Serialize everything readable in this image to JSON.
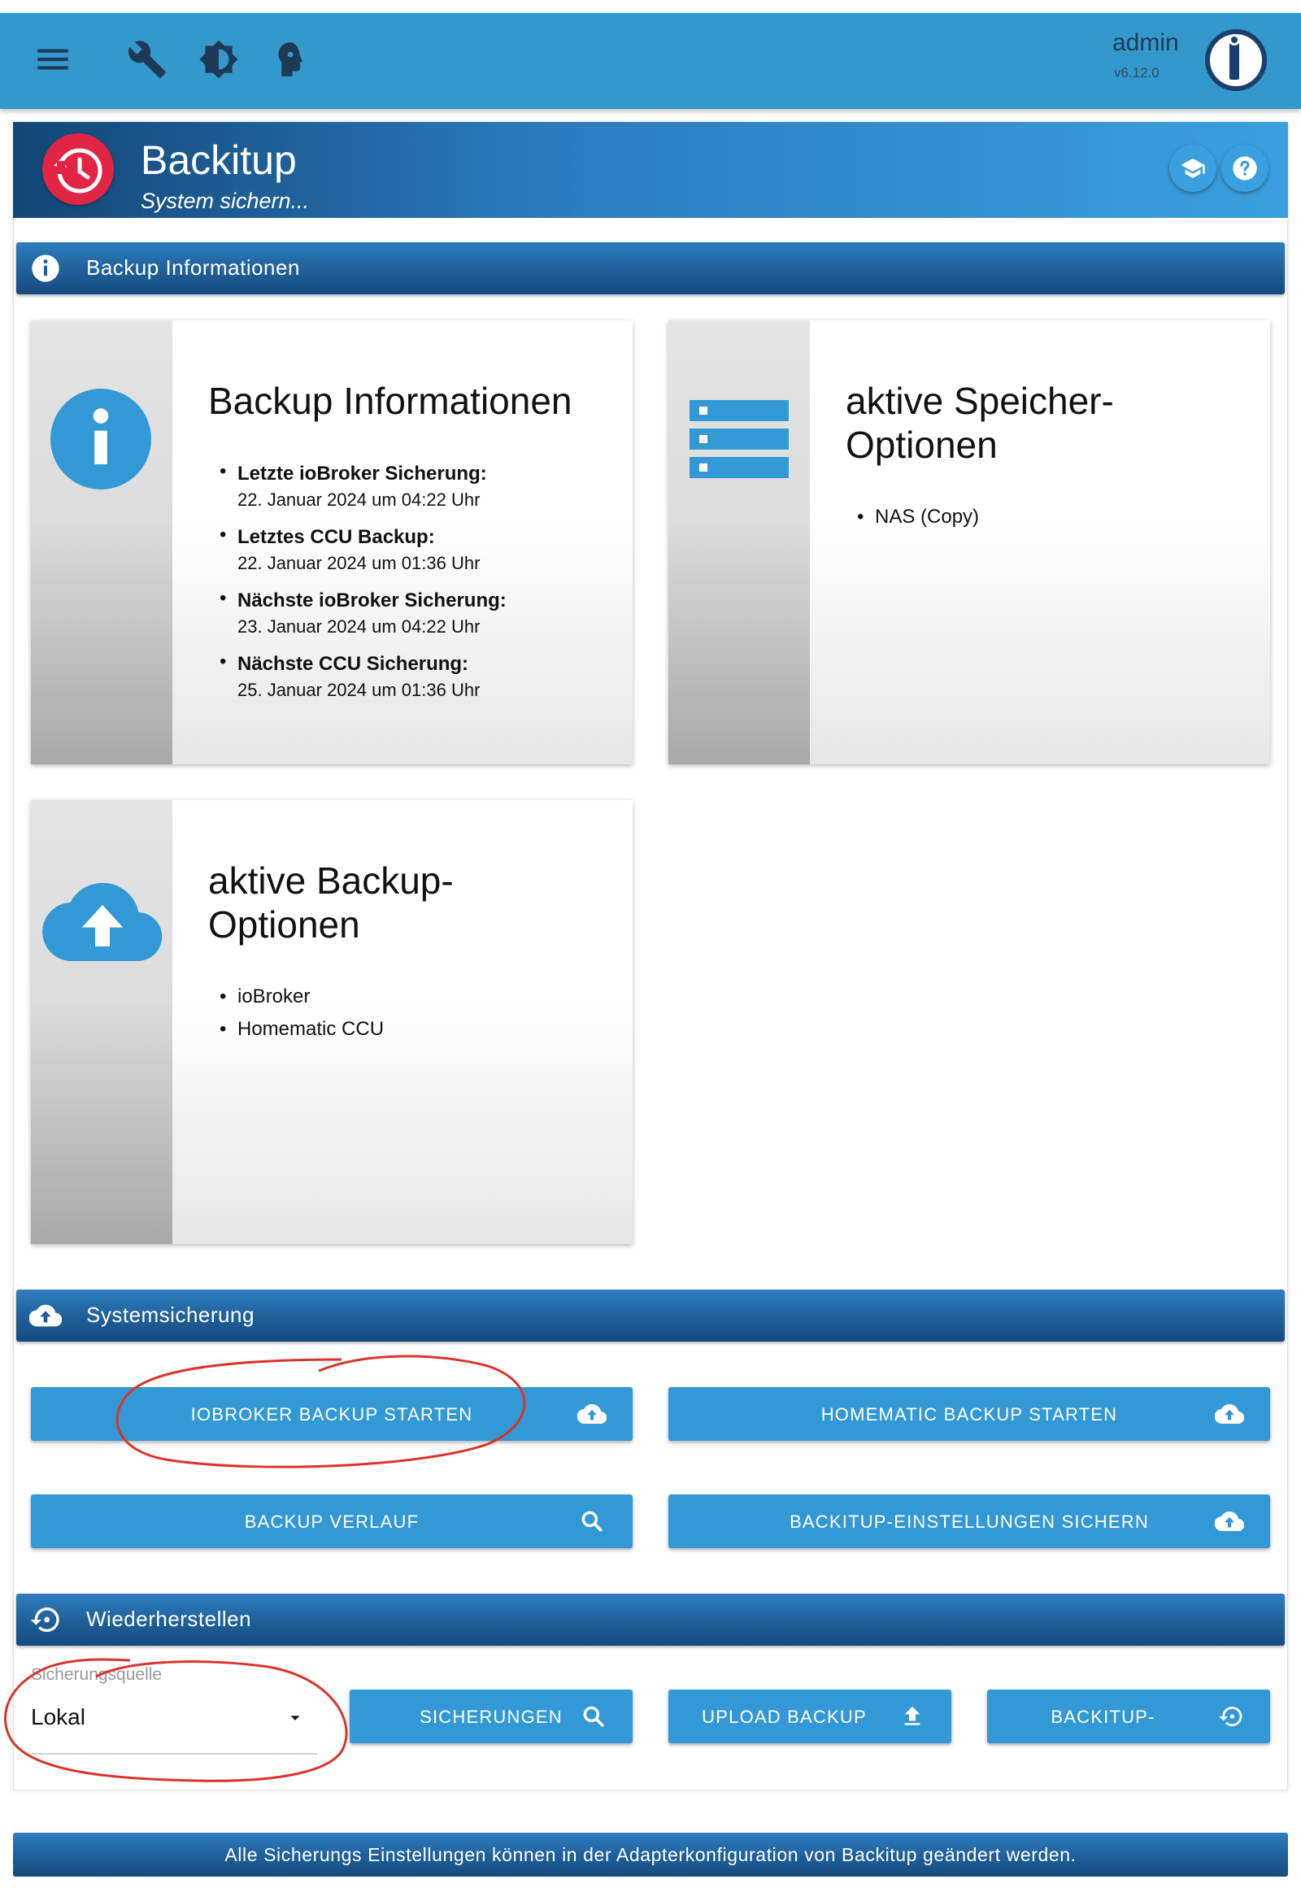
{
  "appbar": {
    "user": "admin",
    "version": "v6.12.0",
    "icons": [
      "menu-icon",
      "wrench-icon",
      "brightness-icon",
      "expert-mode-icon"
    ]
  },
  "adapter": {
    "title": "Backitup",
    "subtitle": "System sichern..."
  },
  "sections": {
    "info": "Backup Informationen",
    "system": "Systemsicherung",
    "restore": "Wiederherstellen"
  },
  "cards": {
    "backup_info": {
      "title": "Backup Informationen",
      "items": [
        {
          "label": "Letzte ioBroker Sicherung:",
          "value": "22. Januar 2024 um 04:22 Uhr"
        },
        {
          "label": "Letztes CCU Backup:",
          "value": "22. Januar 2024 um 01:36 Uhr"
        },
        {
          "label": "Nächste ioBroker Sicherung:",
          "value": "23. Januar 2024 um 04:22 Uhr"
        },
        {
          "label": "Nächste CCU Sicherung:",
          "value": "25. Januar 2024 um 01:36 Uhr"
        }
      ]
    },
    "storage": {
      "title": "aktive Speicher-Optionen",
      "items": [
        "NAS (Copy)"
      ]
    },
    "backup_options": {
      "title": "aktive Backup-Optionen",
      "items": [
        "ioBroker",
        "Homematic CCU"
      ]
    }
  },
  "buttons": {
    "iobroker_backup": "IOBROKER BACKUP STARTEN",
    "homematic_backup": "HOMEMATIC BACKUP STARTEN",
    "backup_history": "BACKUP VERLAUF",
    "save_settings": "BACKITUP-EINSTELLUNGEN SICHERN",
    "backups": "SICHERUNGEN",
    "upload_backup": "UPLOAD BACKUP",
    "backitup_restore": "BACKITUP-"
  },
  "restore": {
    "source_label": "Sicherungsquelle",
    "source_value": "Lokal"
  },
  "footer": {
    "text": "Alle Sicherungs Einstellungen können in der Adapterkonfiguration von Backitup geändert werden."
  },
  "colors": {
    "appbar": "#3399cc",
    "button": "#3399d6",
    "section_bar": "#1f5f99",
    "adapter_logo": "#e22543",
    "annotation": "#d9342b"
  }
}
